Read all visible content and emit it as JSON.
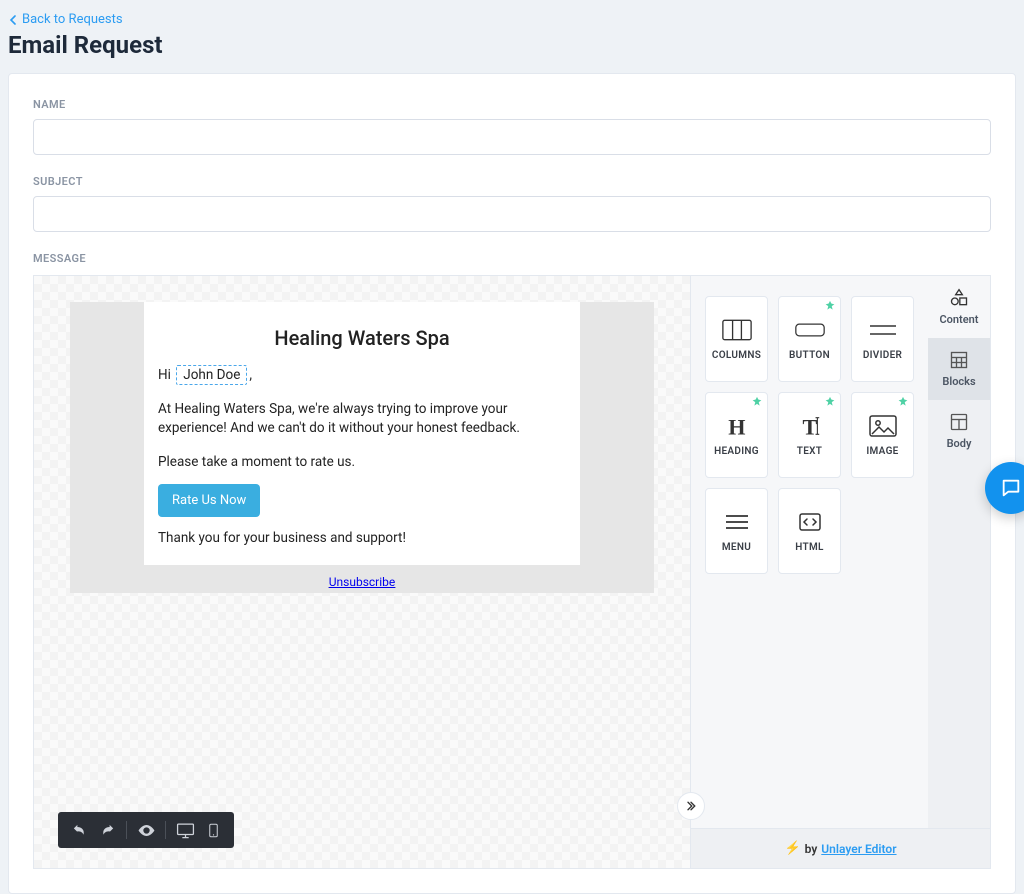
{
  "nav": {
    "back_label": "Back to Requests"
  },
  "page": {
    "title": "Email Request"
  },
  "form": {
    "name_label": "NAME",
    "name_value": "",
    "subject_label": "SUBJECT",
    "subject_value": "",
    "message_label": "MESSAGE"
  },
  "email_preview": {
    "heading": "Healing Waters Spa",
    "greeting_prefix": "Hi",
    "merge_name": "John Doe",
    "greeting_suffix": ",",
    "paragraph1": "At Healing Waters Spa, we're always trying to improve your experience! And we can't do it without your honest feedback.",
    "paragraph2": "Please take a moment to rate us.",
    "cta_label": "Rate Us Now",
    "thanks": "Thank you for your business and support!",
    "unsubscribe": "Unsubscribe"
  },
  "tools": {
    "columns": "COLUMNS",
    "button": "BUTTON",
    "divider": "DIVIDER",
    "heading": "HEADING",
    "text": "TEXT",
    "image": "IMAGE",
    "menu": "MENU",
    "html": "HTML"
  },
  "side_tabs": {
    "content": "Content",
    "blocks": "Blocks",
    "body": "Body"
  },
  "footer": {
    "by": "by",
    "brand": "Unlayer Editor"
  }
}
